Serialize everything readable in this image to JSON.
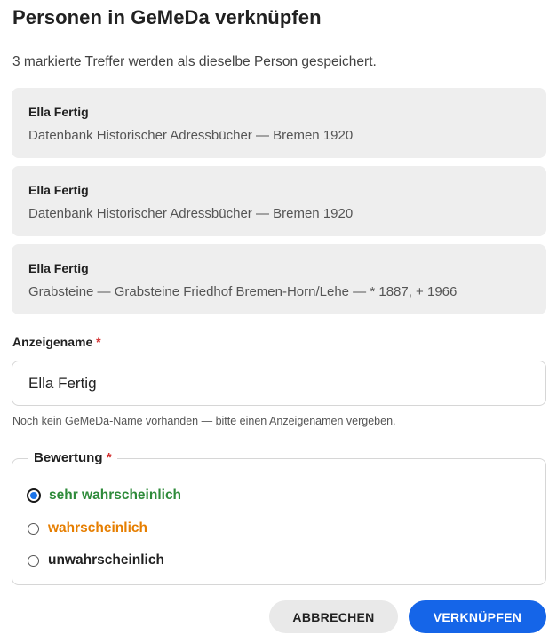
{
  "dialog": {
    "title": "Personen in GeMeDa verknüpfen",
    "subtitle": "3 markierte Treffer werden als dieselbe Person gespeichert."
  },
  "hits": [
    {
      "name": "Ella Fertig",
      "source": "Datenbank Historischer Adressbücher — Bremen 1920"
    },
    {
      "name": "Ella Fertig",
      "source": "Datenbank Historischer Adressbücher — Bremen 1920"
    },
    {
      "name": "Ella Fertig",
      "source": "Grabsteine — Grabsteine Friedhof Bremen-Horn/Lehe — * 1887, + 1966"
    }
  ],
  "display_name": {
    "label": "Anzeigename",
    "required_mark": "*",
    "value": "Ella Fertig",
    "hint": "Noch kein GeMeDa-Name vorhanden — bitte einen Anzeigenamen vergeben."
  },
  "rating": {
    "label": "Bewertung",
    "required_mark": "*",
    "options": [
      {
        "label": "sehr wahrscheinlich",
        "color": "#2e8b3a",
        "checked": true
      },
      {
        "label": "wahrscheinlich",
        "color": "#e67e00",
        "checked": false
      },
      {
        "label": "unwahrscheinlich",
        "color": "#212121",
        "checked": false
      }
    ]
  },
  "actions": {
    "cancel_label": "ABBRECHEN",
    "link_label": "VERKNÜPFEN"
  },
  "colors": {
    "accent": "#1565e8",
    "required": "#d32f2f",
    "card_bg": "#eeeeee"
  }
}
